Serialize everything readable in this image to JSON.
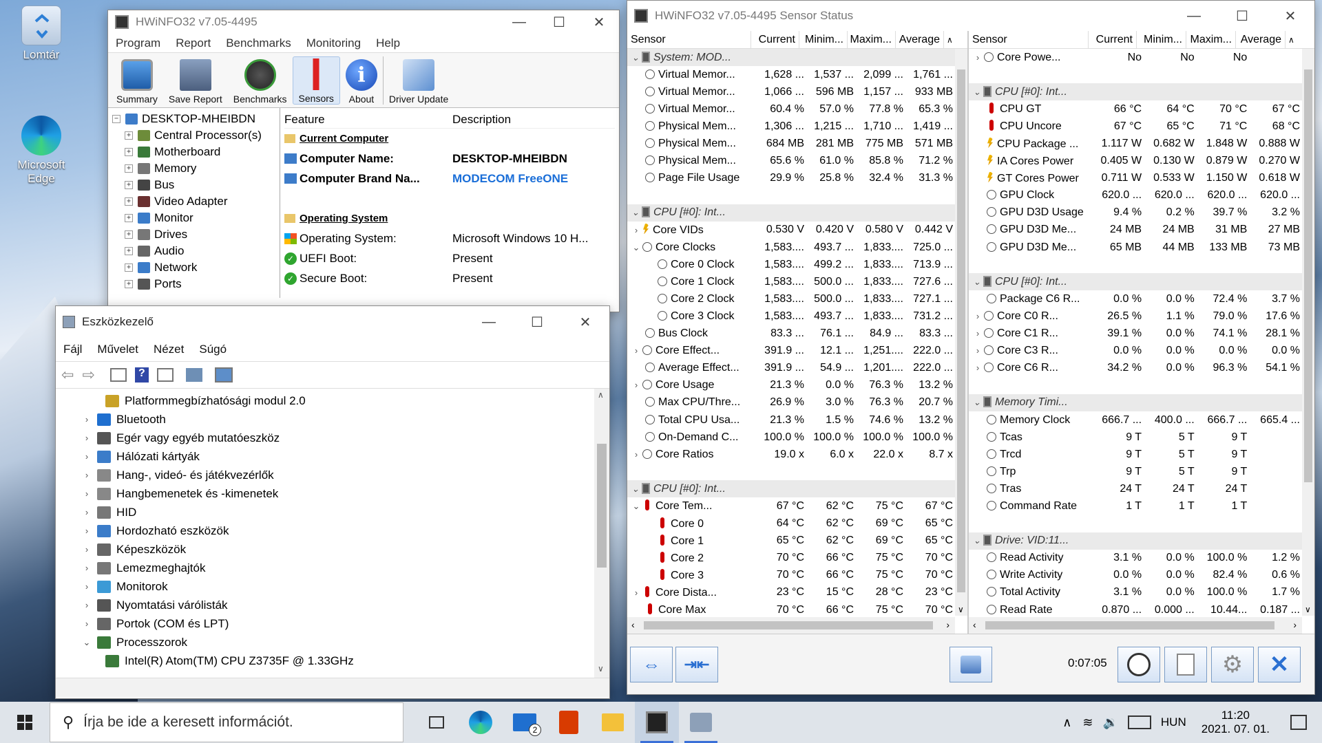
{
  "desktop": {
    "icons": [
      {
        "label": "Lomtár",
        "icon": "recycle-bin-icon"
      },
      {
        "label": "Microsoft Edge",
        "icon": "edge-icon"
      }
    ]
  },
  "hwinfo_main": {
    "title": "HWiNFO32 v7.05-4495",
    "menu": [
      "Program",
      "Report",
      "Benchmarks",
      "Monitoring",
      "Help"
    ],
    "toolbar": [
      "Summary",
      "Save Report",
      "Benchmarks",
      "Sensors",
      "About",
      "Driver Update"
    ],
    "tree_root": "DESKTOP-MHEIBDN",
    "tree": [
      "Central Processor(s)",
      "Motherboard",
      "Memory",
      "Bus",
      "Video Adapter",
      "Monitor",
      "Drives",
      "Audio",
      "Network",
      "Ports"
    ],
    "feature_header": "Feature",
    "description_header": "Description",
    "current_computer": "Current Computer",
    "computer_name_label": "Computer Name:",
    "computer_name": "DESKTOP-MHEIBDN",
    "brand_label": "Computer Brand Na...",
    "brand": "MODECOM FreeONE",
    "os_section": "Operating System",
    "os_label": "Operating System:",
    "os_value": "Microsoft Windows 10 H...",
    "uefi_label": "UEFI Boot:",
    "uefi_value": "Present",
    "secure_label": "Secure Boot:",
    "secure_value": "Present"
  },
  "device_manager": {
    "title": "Eszközkezelő",
    "menu": [
      "Fájl",
      "Művelet",
      "Nézet",
      "Súgó"
    ],
    "items": [
      {
        "label": "Platformmegbízhatósági modul 2.0",
        "indent": 1,
        "arrow": ""
      },
      {
        "label": "Bluetooth",
        "indent": 0,
        "arrow": "›"
      },
      {
        "label": "Egér vagy egyéb mutatóeszköz",
        "indent": 0,
        "arrow": "›"
      },
      {
        "label": "Hálózati kártyák",
        "indent": 0,
        "arrow": "›"
      },
      {
        "label": "Hang-, videó- és játékvezérlők",
        "indent": 0,
        "arrow": "›"
      },
      {
        "label": "Hangbemenetek és -kimenetek",
        "indent": 0,
        "arrow": "›"
      },
      {
        "label": "HID",
        "indent": 0,
        "arrow": "›"
      },
      {
        "label": "Hordozható eszközök",
        "indent": 0,
        "arrow": "›"
      },
      {
        "label": "Képeszközök",
        "indent": 0,
        "arrow": "›"
      },
      {
        "label": "Lemezmeghajtók",
        "indent": 0,
        "arrow": "›"
      },
      {
        "label": "Monitorok",
        "indent": 0,
        "arrow": "›"
      },
      {
        "label": "Nyomtatási várólisták",
        "indent": 0,
        "arrow": "›"
      },
      {
        "label": "Portok (COM és LPT)",
        "indent": 0,
        "arrow": "›"
      },
      {
        "label": "Processzorok",
        "indent": 0,
        "arrow": "⌄"
      },
      {
        "label": "Intel(R) Atom(TM) CPU  Z3735F @ 1.33GHz",
        "indent": 1,
        "arrow": ""
      }
    ]
  },
  "sensor_status": {
    "title": "HWiNFO32 v7.05-4495 Sensor Status",
    "columns": [
      "Sensor",
      "Current",
      "Minim...",
      "Maxim...",
      "Average"
    ],
    "left": [
      {
        "t": "grp",
        "name": "System: MOD..."
      },
      {
        "t": "row",
        "ico": "c",
        "lvl": 0,
        "name": "Virtual Memor...",
        "v": [
          "1,628 ...",
          "1,537 ...",
          "2,099 ...",
          "1,761 ..."
        ]
      },
      {
        "t": "row",
        "ico": "c",
        "lvl": 0,
        "name": "Virtual Memor...",
        "v": [
          "1,066 ...",
          "596 MB",
          "1,157 ...",
          "933 MB"
        ]
      },
      {
        "t": "row",
        "ico": "c",
        "lvl": 0,
        "name": "Virtual Memor...",
        "v": [
          "60.4 %",
          "57.0 %",
          "77.8 %",
          "65.3 %"
        ]
      },
      {
        "t": "row",
        "ico": "c",
        "lvl": 0,
        "name": "Physical Mem...",
        "v": [
          "1,306 ...",
          "1,215 ...",
          "1,710 ...",
          "1,419 ..."
        ]
      },
      {
        "t": "row",
        "ico": "c",
        "lvl": 0,
        "name": "Physical Mem...",
        "v": [
          "684 MB",
          "281 MB",
          "775 MB",
          "571 MB"
        ]
      },
      {
        "t": "row",
        "ico": "c",
        "lvl": 0,
        "name": "Physical Mem...",
        "v": [
          "65.6 %",
          "61.0 %",
          "85.8 %",
          "71.2 %"
        ]
      },
      {
        "t": "row",
        "ico": "c",
        "lvl": 0,
        "name": "Page File Usage",
        "v": [
          "29.9 %",
          "25.8 %",
          "32.4 %",
          "31.3 %"
        ]
      },
      {
        "t": "blank"
      },
      {
        "t": "grp",
        "name": "CPU [#0]: Int..."
      },
      {
        "t": "row",
        "ico": "p",
        "lvl": 1,
        "exp": "›",
        "name": "Core VIDs",
        "v": [
          "0.530 V",
          "0.420 V",
          "0.580 V",
          "0.442 V"
        ]
      },
      {
        "t": "row",
        "ico": "c",
        "lvl": 1,
        "exp": "⌄",
        "name": "Core Clocks",
        "v": [
          "1,583....",
          "493.7 ...",
          "1,833....",
          "725.0 ..."
        ]
      },
      {
        "t": "row",
        "ico": "c",
        "lvl": 2,
        "name": "Core 0 Clock",
        "v": [
          "1,583....",
          "499.2 ...",
          "1,833....",
          "713.9 ..."
        ]
      },
      {
        "t": "row",
        "ico": "c",
        "lvl": 2,
        "name": "Core 1 Clock",
        "v": [
          "1,583....",
          "500.0 ...",
          "1,833....",
          "727.6 ..."
        ]
      },
      {
        "t": "row",
        "ico": "c",
        "lvl": 2,
        "name": "Core 2 Clock",
        "v": [
          "1,583....",
          "500.0 ...",
          "1,833....",
          "727.1 ..."
        ]
      },
      {
        "t": "row",
        "ico": "c",
        "lvl": 2,
        "name": "Core 3 Clock",
        "v": [
          "1,583....",
          "493.7 ...",
          "1,833....",
          "731.2 ..."
        ]
      },
      {
        "t": "row",
        "ico": "c",
        "lvl": 0,
        "name": "Bus Clock",
        "v": [
          "83.3 ...",
          "76.1 ...",
          "84.9 ...",
          "83.3 ..."
        ]
      },
      {
        "t": "row",
        "ico": "c",
        "lvl": 1,
        "exp": "›",
        "name": "Core Effect...",
        "v": [
          "391.9 ...",
          "12.1 ...",
          "1,251....",
          "222.0 ..."
        ]
      },
      {
        "t": "row",
        "ico": "c",
        "lvl": 0,
        "name": "Average Effect...",
        "v": [
          "391.9 ...",
          "54.9 ...",
          "1,201....",
          "222.0 ..."
        ]
      },
      {
        "t": "row",
        "ico": "c",
        "lvl": 1,
        "exp": "›",
        "name": "Core Usage",
        "v": [
          "21.3 %",
          "0.0 %",
          "76.3 %",
          "13.2 %"
        ]
      },
      {
        "t": "row",
        "ico": "c",
        "lvl": 0,
        "name": "Max CPU/Thre...",
        "v": [
          "26.9 %",
          "3.0 %",
          "76.3 %",
          "20.7 %"
        ]
      },
      {
        "t": "row",
        "ico": "c",
        "lvl": 0,
        "name": "Total CPU Usa...",
        "v": [
          "21.3 %",
          "1.5 %",
          "74.6 %",
          "13.2 %"
        ]
      },
      {
        "t": "row",
        "ico": "c",
        "lvl": 0,
        "name": "On-Demand C...",
        "v": [
          "100.0 %",
          "100.0 %",
          "100.0 %",
          "100.0 %"
        ]
      },
      {
        "t": "row",
        "ico": "c",
        "lvl": 1,
        "exp": "›",
        "name": "Core Ratios",
        "v": [
          "19.0 x",
          "6.0 x",
          "22.0 x",
          "8.7 x"
        ]
      },
      {
        "t": "blank"
      },
      {
        "t": "grp",
        "name": "CPU [#0]: Int..."
      },
      {
        "t": "row",
        "ico": "t",
        "lvl": 1,
        "exp": "⌄",
        "name": "Core Tem...",
        "v": [
          "67 °C",
          "62 °C",
          "75 °C",
          "67 °C"
        ]
      },
      {
        "t": "row",
        "ico": "t",
        "lvl": 2,
        "name": "Core 0",
        "v": [
          "64 °C",
          "62 °C",
          "69 °C",
          "65 °C"
        ]
      },
      {
        "t": "row",
        "ico": "t",
        "lvl": 2,
        "name": "Core 1",
        "v": [
          "65 °C",
          "62 °C",
          "69 °C",
          "65 °C"
        ]
      },
      {
        "t": "row",
        "ico": "t",
        "lvl": 2,
        "name": "Core 2",
        "v": [
          "70 °C",
          "66 °C",
          "75 °C",
          "70 °C"
        ]
      },
      {
        "t": "row",
        "ico": "t",
        "lvl": 2,
        "name": "Core 3",
        "v": [
          "70 °C",
          "66 °C",
          "75 °C",
          "70 °C"
        ]
      },
      {
        "t": "row",
        "ico": "t",
        "lvl": 1,
        "exp": "›",
        "name": "Core Dista...",
        "v": [
          "23 °C",
          "15 °C",
          "28 °C",
          "23 °C"
        ]
      },
      {
        "t": "row",
        "ico": "t",
        "lvl": 0,
        "name": "Core Max",
        "v": [
          "70 °C",
          "66 °C",
          "75 °C",
          "70 °C"
        ]
      }
    ],
    "right": [
      {
        "t": "row",
        "ico": "c",
        "lvl": 1,
        "exp": "›",
        "name": "Core Powe...",
        "v": [
          "No",
          "No",
          "No",
          ""
        ]
      },
      {
        "t": "blank"
      },
      {
        "t": "grp",
        "name": "CPU [#0]: Int..."
      },
      {
        "t": "row",
        "ico": "t",
        "lvl": 0,
        "name": "CPU GT",
        "v": [
          "66 °C",
          "64 °C",
          "70 °C",
          "67 °C"
        ]
      },
      {
        "t": "row",
        "ico": "t",
        "lvl": 0,
        "name": "CPU Uncore",
        "v": [
          "67 °C",
          "65 °C",
          "71 °C",
          "68 °C"
        ]
      },
      {
        "t": "row",
        "ico": "p",
        "lvl": 0,
        "name": "CPU Package ...",
        "v": [
          "1.117 W",
          "0.682 W",
          "1.848 W",
          "0.888 W"
        ]
      },
      {
        "t": "row",
        "ico": "p",
        "lvl": 0,
        "name": "IA Cores Power",
        "v": [
          "0.405 W",
          "0.130 W",
          "0.879 W",
          "0.270 W"
        ]
      },
      {
        "t": "row",
        "ico": "p",
        "lvl": 0,
        "name": "GT Cores Power",
        "v": [
          "0.711 W",
          "0.533 W",
          "1.150 W",
          "0.618 W"
        ]
      },
      {
        "t": "row",
        "ico": "c",
        "lvl": 0,
        "name": "GPU Clock",
        "v": [
          "620.0 ...",
          "620.0 ...",
          "620.0 ...",
          "620.0 ..."
        ]
      },
      {
        "t": "row",
        "ico": "c",
        "lvl": 0,
        "name": "GPU D3D Usage",
        "v": [
          "9.4 %",
          "0.2 %",
          "39.7 %",
          "3.2 %"
        ]
      },
      {
        "t": "row",
        "ico": "c",
        "lvl": 0,
        "name": "GPU D3D Me...",
        "v": [
          "24 MB",
          "24 MB",
          "31 MB",
          "27 MB"
        ]
      },
      {
        "t": "row",
        "ico": "c",
        "lvl": 0,
        "name": "GPU D3D Me...",
        "v": [
          "65 MB",
          "44 MB",
          "133 MB",
          "73 MB"
        ]
      },
      {
        "t": "blank"
      },
      {
        "t": "grp",
        "name": "CPU [#0]: Int..."
      },
      {
        "t": "row",
        "ico": "c",
        "lvl": 0,
        "name": "Package C6 R...",
        "v": [
          "0.0 %",
          "0.0 %",
          "72.4 %",
          "3.7 %"
        ]
      },
      {
        "t": "row",
        "ico": "c",
        "lvl": 1,
        "exp": "›",
        "name": "Core C0 R...",
        "v": [
          "26.5 %",
          "1.1 %",
          "79.0 %",
          "17.6 %"
        ]
      },
      {
        "t": "row",
        "ico": "c",
        "lvl": 1,
        "exp": "›",
        "name": "Core C1 R...",
        "v": [
          "39.1 %",
          "0.0 %",
          "74.1 %",
          "28.1 %"
        ]
      },
      {
        "t": "row",
        "ico": "c",
        "lvl": 1,
        "exp": "›",
        "name": "Core C3 R...",
        "v": [
          "0.0 %",
          "0.0 %",
          "0.0 %",
          "0.0 %"
        ]
      },
      {
        "t": "row",
        "ico": "c",
        "lvl": 1,
        "exp": "›",
        "name": "Core C6 R...",
        "v": [
          "34.2 %",
          "0.0 %",
          "96.3 %",
          "54.1 %"
        ]
      },
      {
        "t": "blank"
      },
      {
        "t": "grp",
        "name": "Memory Timi..."
      },
      {
        "t": "row",
        "ico": "c",
        "lvl": 0,
        "name": "Memory Clock",
        "v": [
          "666.7 ...",
          "400.0 ...",
          "666.7 ...",
          "665.4 ..."
        ]
      },
      {
        "t": "row",
        "ico": "c",
        "lvl": 0,
        "name": "Tcas",
        "v": [
          "9 T",
          "5 T",
          "9 T",
          ""
        ]
      },
      {
        "t": "row",
        "ico": "c",
        "lvl": 0,
        "name": "Trcd",
        "v": [
          "9 T",
          "5 T",
          "9 T",
          ""
        ]
      },
      {
        "t": "row",
        "ico": "c",
        "lvl": 0,
        "name": "Trp",
        "v": [
          "9 T",
          "5 T",
          "9 T",
          ""
        ]
      },
      {
        "t": "row",
        "ico": "c",
        "lvl": 0,
        "name": "Tras",
        "v": [
          "24 T",
          "24 T",
          "24 T",
          ""
        ]
      },
      {
        "t": "row",
        "ico": "c",
        "lvl": 0,
        "name": "Command Rate",
        "v": [
          "1 T",
          "1 T",
          "1 T",
          ""
        ]
      },
      {
        "t": "blank"
      },
      {
        "t": "grp",
        "name": "Drive: VID:11..."
      },
      {
        "t": "row",
        "ico": "c",
        "lvl": 0,
        "name": "Read Activity",
        "v": [
          "3.1 %",
          "0.0 %",
          "100.0 %",
          "1.2 %"
        ]
      },
      {
        "t": "row",
        "ico": "c",
        "lvl": 0,
        "name": "Write Activity",
        "v": [
          "0.0 %",
          "0.0 %",
          "82.4 %",
          "0.6 %"
        ]
      },
      {
        "t": "row",
        "ico": "c",
        "lvl": 0,
        "name": "Total Activity",
        "v": [
          "3.1 %",
          "0.0 %",
          "100.0 %",
          "1.7 %"
        ]
      },
      {
        "t": "row",
        "ico": "c",
        "lvl": 0,
        "name": "Read Rate",
        "v": [
          "0.870 ...",
          "0.000 ...",
          "10.44...",
          "0.187 ..."
        ]
      }
    ],
    "timer": "0:07:05"
  },
  "taskbar": {
    "search_placeholder": "Írja be ide a keresett információt.",
    "mail_badge": "2",
    "language": "HUN",
    "time": "11:20",
    "date": "2021. 07. 01."
  },
  "colors": {
    "accent": "#1f6fcf",
    "brand_link": "#1a6ed8",
    "taskbar_bg": "#dfe4ea"
  }
}
